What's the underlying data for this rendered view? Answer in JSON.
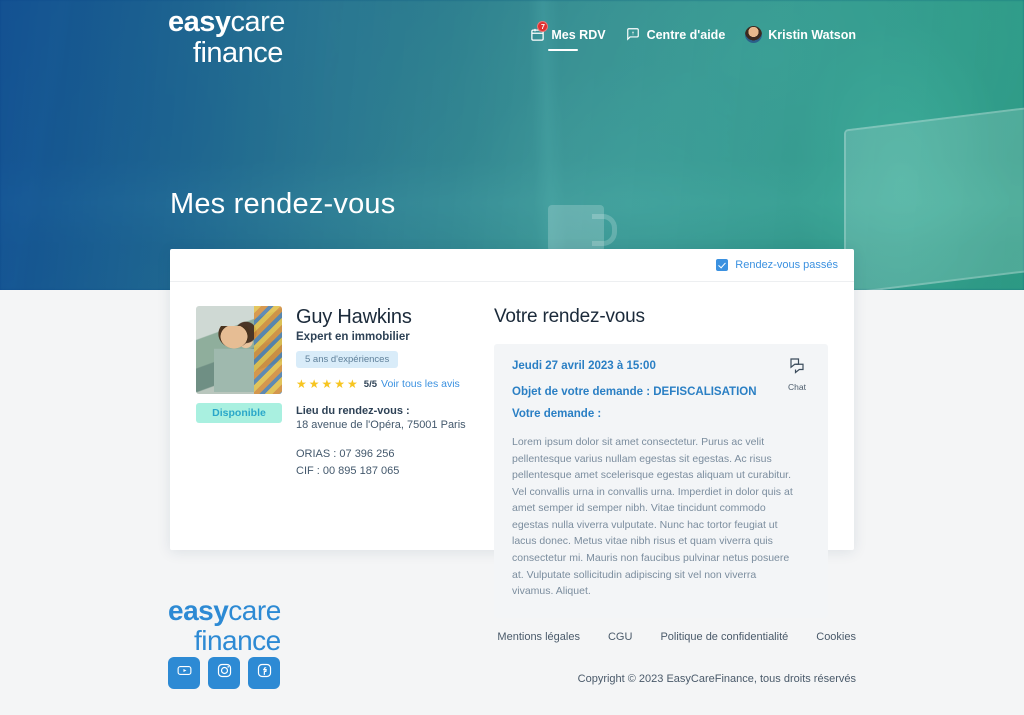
{
  "brand": {
    "logo_word_1_bold": "easy",
    "logo_word_1_light": "care",
    "logo_word_2": "finance"
  },
  "header": {
    "nav": [
      {
        "label": "Mes RDV",
        "icon": "calendar-icon",
        "badge": "7",
        "active": true
      },
      {
        "label": "Centre d'aide",
        "icon": "help-chat-icon",
        "badge": "",
        "active": false
      },
      {
        "label": "Kristin Watson",
        "icon": "avatar-icon",
        "badge": "",
        "active": false
      }
    ]
  },
  "hero": {
    "title": "Mes rendez-vous"
  },
  "card": {
    "filter": {
      "checkbox_label": "Rendez-vous passés",
      "checked": true
    },
    "advisor": {
      "name": "Guy Hawkins",
      "role": "Expert en immobilier",
      "experience_badge": "5 ans d'expériences",
      "stars": "★★★★★",
      "rating": "5/5",
      "reviews_link": "Voir tous les avis",
      "availability_badge": "Disponible",
      "location_label": "Lieu du rendez-vous :",
      "location_value": "18 avenue de l'Opéra, 75001 Paris",
      "orias": "ORIAS : 07 396 256",
      "cif": "CIF : 00 895 187 065"
    },
    "appointment": {
      "section_title": "Votre rendez-vous",
      "datetime": "Jeudi 27 avril 2023 à 15:00",
      "subject": "Objet de votre demande : DEFISCALISATION",
      "request_label": "Votre demande :",
      "request_text": "Lorem ipsum dolor sit amet consectetur. Purus ac velit pellentesque varius nullam egestas sit egestas. Ac risus pellentesque amet scelerisque egestas aliquam ut curabitur. Vel convallis urna in convallis urna. Imperdiet in dolor quis at amet semper id semper nibh. Vitae tincidunt commodo egestas nulla viverra vulputate. Nunc hac tortor feugiat ut lacus donec. Metus vitae nibh risus et quam viverra quis consectetur mi. Mauris non faucibus pulvinar netus posuere at. Vulputate sollicitudin adipiscing sit vel non viverra vivamus. Aliquet.",
      "chat_label": "Chat",
      "chat_icon": "chat-bubbles-icon"
    }
  },
  "footer": {
    "socials": [
      {
        "name": "youtube-icon"
      },
      {
        "name": "instagram-icon"
      },
      {
        "name": "facebook-icon"
      }
    ],
    "links": [
      "Mentions légales",
      "CGU",
      "Politique de confidentialité",
      "Cookies"
    ],
    "copyright": "Copyright ©  2023 EasyCareFinance, tous droits réservés"
  },
  "colors": {
    "accent_blue": "#2d8ad4",
    "link_blue": "#3b91e0",
    "heading_blue": "#2a7fc4",
    "available_bg": "#a9f0e0",
    "available_text": "#2aa7c9",
    "star_yellow": "#f7c520",
    "badge_red": "#e03030",
    "page_bg": "#f4f5f6"
  }
}
